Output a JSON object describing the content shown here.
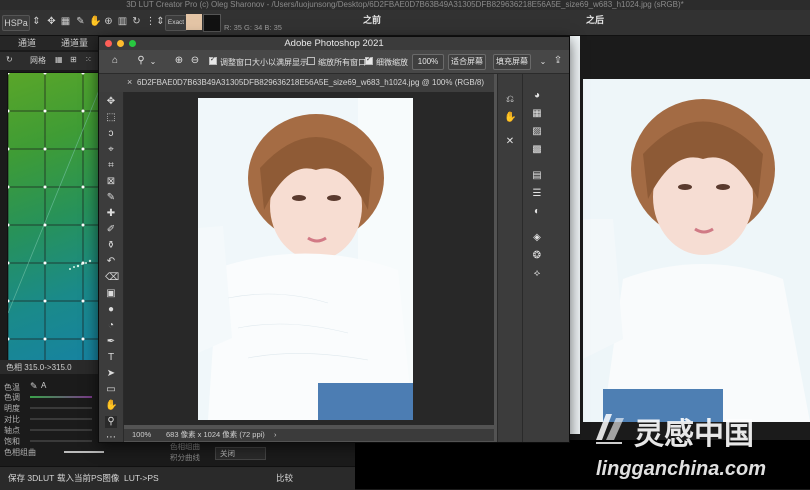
{
  "lut_app": {
    "window_title": "3D LUT Creator Pro (c) Oleg Sharonov - /Users/luojunsong/Desktop/6D2FBAE0D7B63B49A31305DFB829636218E56A5E_size69_w683_h1024.jpg (sRGB)*",
    "toolbar": {
      "mode": "HSPa",
      "exact_label": "Exact",
      "rgb_top": "R: 35   G: 34   B: 35",
      "rgb_bottom": "R: 35   G: 34   B: 35",
      "swatch_color": "#e4c5a6"
    },
    "tabs": [
      "通道",
      "通道量"
    ],
    "grid_label": "网格",
    "hue_readout": "色相 315.0->315.0",
    "sliders": [
      "色温",
      "色调",
      "明度",
      "对比",
      "轴点",
      "饱和",
      "色相组曲"
    ],
    "lower_labels": [
      "色相组曲",
      "积分曲线"
    ],
    "lower_select": "关闭",
    "bottom_buttons": [
      "保存 3DLUT",
      "载入当前PS图像",
      "LUT->PS"
    ],
    "compare_label": "比较",
    "before_label": "之前",
    "after_label": "之后"
  },
  "photoshop": {
    "window_title": "Adobe Photoshop 2021",
    "options": {
      "resize_windows": "调整窗口大小以满屏显示",
      "zoom_all": "缩放所有窗口",
      "scrubby_zoom": "细微缩放",
      "zoom_value": "100%",
      "fit_screen": "适合屏幕",
      "fill_screen": "填充屏幕"
    },
    "doc_tab": "6D2FBAE0D7B63B49A31305DFB829636218E56A5E_size69_w683_h1024.jpg @ 100% (RGB/8)",
    "status_zoom": "100%",
    "status_info": "683 像素 x 1024 像素 (72 ppi)",
    "status_arrow": "›"
  },
  "watermark": {
    "cn": "灵感中国",
    "en": "lingganchina.com"
  }
}
